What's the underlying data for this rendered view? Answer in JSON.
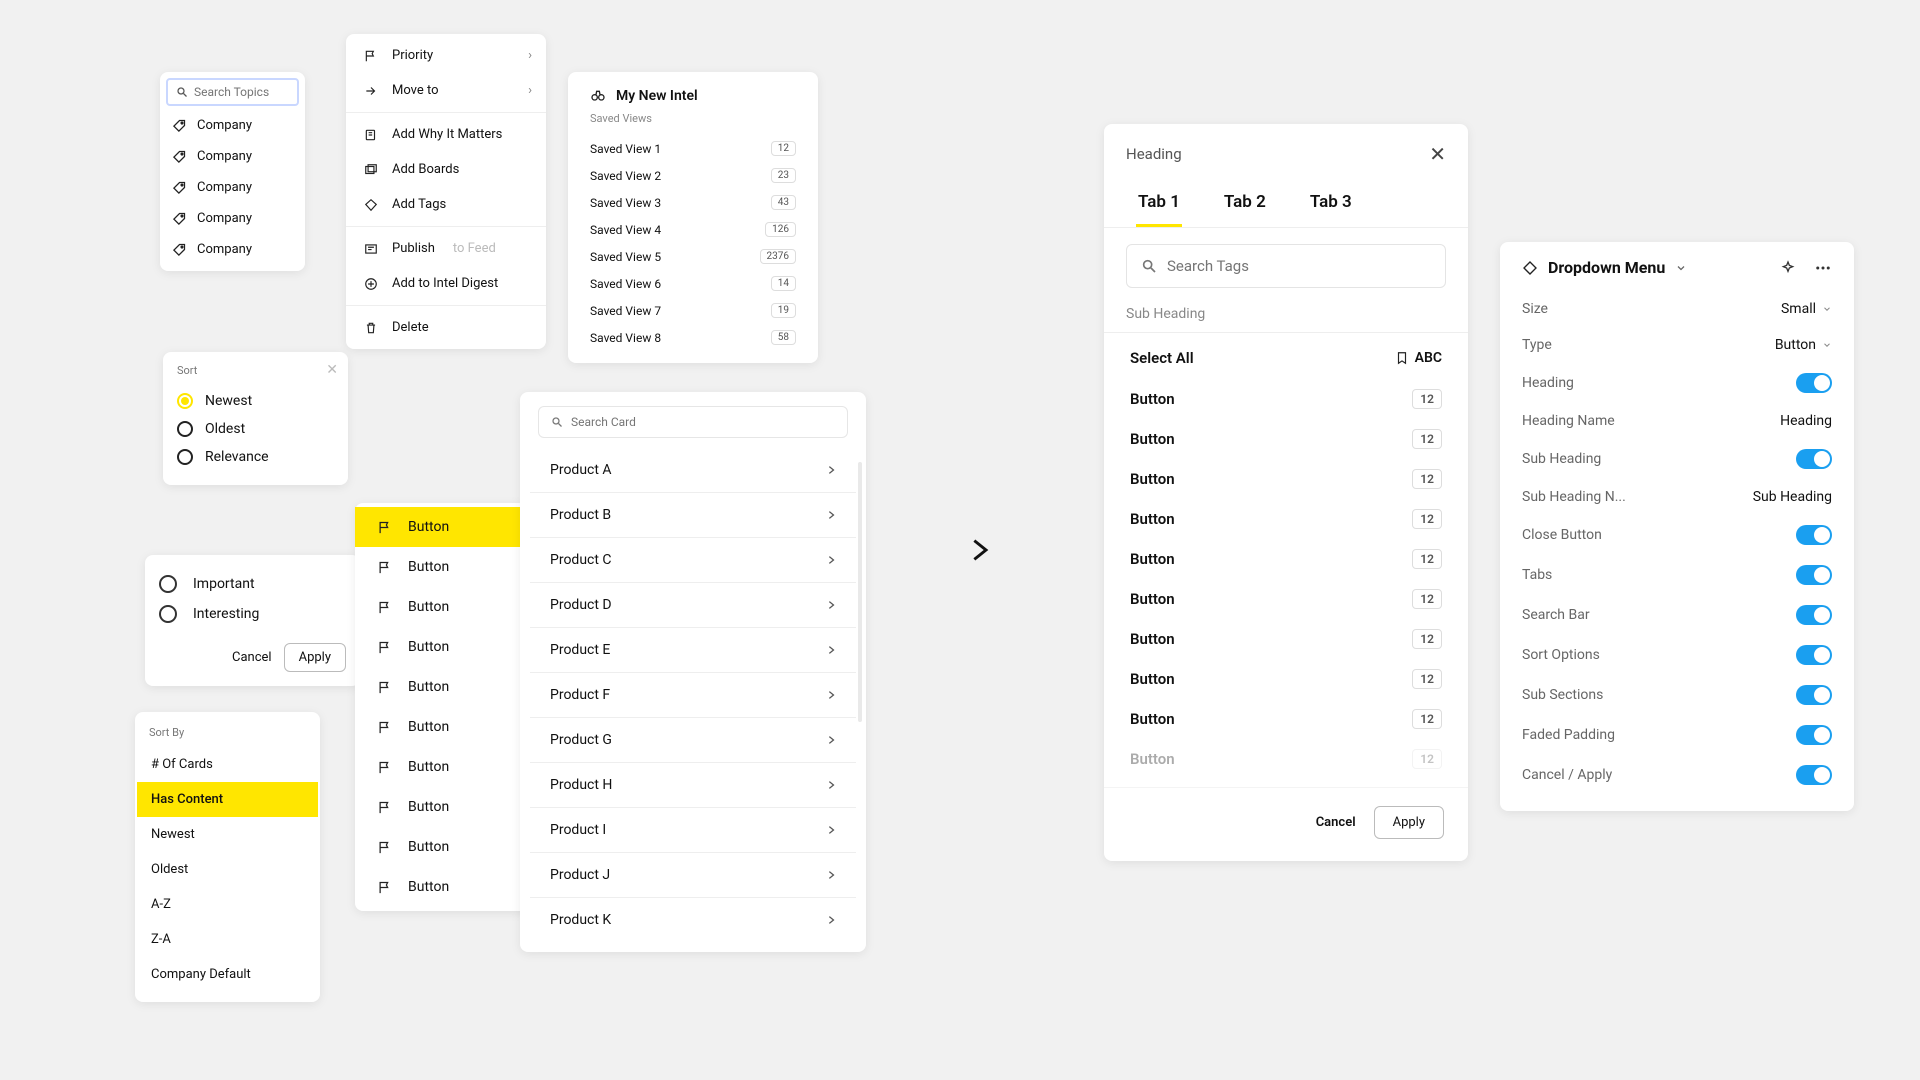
{
  "search_topics": {
    "placeholder": "Search Topics",
    "items": [
      "Company",
      "Company",
      "Company",
      "Company",
      "Company"
    ]
  },
  "sort": {
    "title": "Sort",
    "options": [
      "Newest",
      "Oldest",
      "Relevance"
    ],
    "selected": 0
  },
  "importance": {
    "options": [
      "Important",
      "Interesting"
    ],
    "cancel": "Cancel",
    "apply": "Apply"
  },
  "sort_by": {
    "title": "Sort By",
    "items": [
      "# Of Cards",
      "Has Content",
      "Newest",
      "Oldest",
      "A-Z",
      "Z-A",
      "Company Default"
    ],
    "active": 1
  },
  "context_menu": {
    "priority": "Priority",
    "move_to": "Move to",
    "add_why": "Add Why It Matters",
    "add_boards": "Add Boards",
    "add_tags": "Add Tags",
    "publish": "Publish",
    "publish_suffix": "to Feed",
    "add_digest": "Add to Intel Digest",
    "delete": "Delete"
  },
  "flag_list": {
    "items": [
      "Button",
      "Button",
      "Button",
      "Button",
      "Button",
      "Button",
      "Button",
      "Button",
      "Button",
      "Button"
    ],
    "active": 0
  },
  "intel": {
    "title": "My New Intel",
    "sub": "Saved Views",
    "views": [
      {
        "name": "Saved View 1",
        "count": "12"
      },
      {
        "name": "Saved View 2",
        "count": "23"
      },
      {
        "name": "Saved View 3",
        "count": "43"
      },
      {
        "name": "Saved View 4",
        "count": "126"
      },
      {
        "name": "Saved View 5",
        "count": "2376"
      },
      {
        "name": "Saved View 6",
        "count": "14"
      },
      {
        "name": "Saved View 7",
        "count": "19"
      },
      {
        "name": "Saved View 8",
        "count": "58"
      }
    ]
  },
  "products": {
    "search_placeholder": "Search Card",
    "items": [
      "Product A",
      "Product B",
      "Product C",
      "Product D",
      "Product E",
      "Product F",
      "Product G",
      "Product H",
      "Product I",
      "Product J",
      "Product K"
    ]
  },
  "dropdown_dialog": {
    "heading": "Heading",
    "tabs": [
      "Tab 1",
      "Tab 2",
      "Tab 3"
    ],
    "active_tab": 0,
    "search_placeholder": "Search Tags",
    "sub_heading": "Sub Heading",
    "select_all": "Select All",
    "abc": "ABC",
    "rows": [
      "Button",
      "Button",
      "Button",
      "Button",
      "Button",
      "Button",
      "Button",
      "Button",
      "Button",
      "Button"
    ],
    "row_count": "12",
    "cancel": "Cancel",
    "apply": "Apply"
  },
  "inspector": {
    "title": "Dropdown Menu",
    "props": {
      "size_label": "Size",
      "size_value": "Small",
      "type_label": "Type",
      "type_value": "Button",
      "heading_label": "Heading",
      "heading_name_label": "Heading Name",
      "heading_name_value": "Heading",
      "sub_heading_label": "Sub Heading",
      "sub_heading_name_label": "Sub Heading N...",
      "sub_heading_name_value": "Sub Heading",
      "close_button_label": "Close Button",
      "tabs_label": "Tabs",
      "search_bar_label": "Search Bar",
      "sort_options_label": "Sort Options",
      "sub_sections_label": "Sub Sections",
      "faded_padding_label": "Faded Padding",
      "cancel_apply_label": "Cancel / Apply"
    }
  }
}
